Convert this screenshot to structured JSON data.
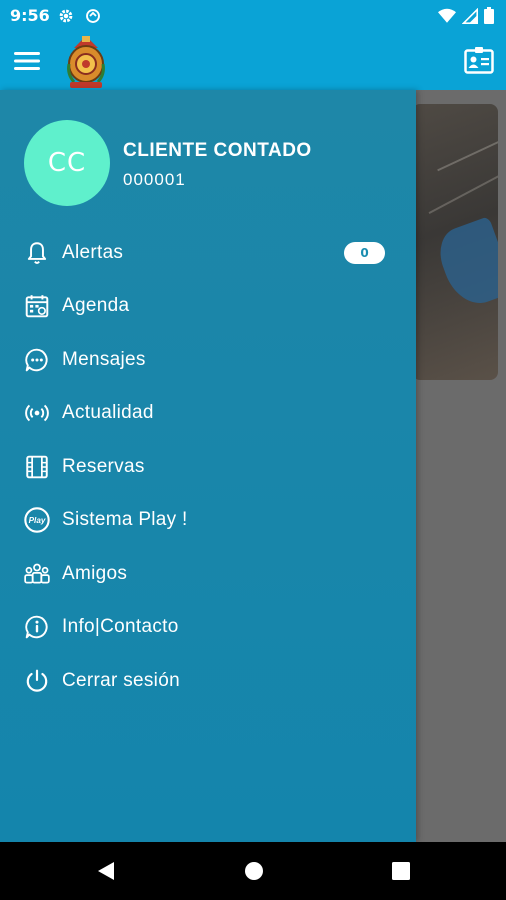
{
  "status_bar": {
    "time": "9:56",
    "icons": [
      "gear-icon",
      "data-saver-icon",
      "wifi-icon",
      "signal-icon",
      "battery-icon"
    ]
  },
  "app_bar": {
    "icons": [
      "hamburger-menu-icon",
      "club-logo",
      "id-card-icon"
    ]
  },
  "profile": {
    "initials": "CC",
    "name": "CLIENTE CONTADO",
    "code": "000001",
    "avatar_color": "#5ff0cc"
  },
  "menu": {
    "items": [
      {
        "label": "Alertas",
        "icon": "bell-icon",
        "badge": "0"
      },
      {
        "label": "Agenda",
        "icon": "calendar-icon"
      },
      {
        "label": "Mensajes",
        "icon": "chat-bubble-icon"
      },
      {
        "label": "Actualidad",
        "icon": "broadcast-icon"
      },
      {
        "label": "Reservas",
        "icon": "film-reservation-icon"
      },
      {
        "label": "Sistema Play !",
        "icon": "play-badge-icon"
      },
      {
        "label": "Amigos",
        "icon": "friends-icon"
      },
      {
        "label": "Info|Contacto",
        "icon": "info-chat-icon"
      },
      {
        "label": "Cerrar sesión",
        "icon": "power-icon"
      }
    ]
  },
  "colors": {
    "primary": "#0aa3d6",
    "drawer": "#1a86aa",
    "accent": "#5ff0cc"
  },
  "nav_bar": {
    "icons": [
      "back-icon",
      "home-icon",
      "recents-icon"
    ]
  }
}
